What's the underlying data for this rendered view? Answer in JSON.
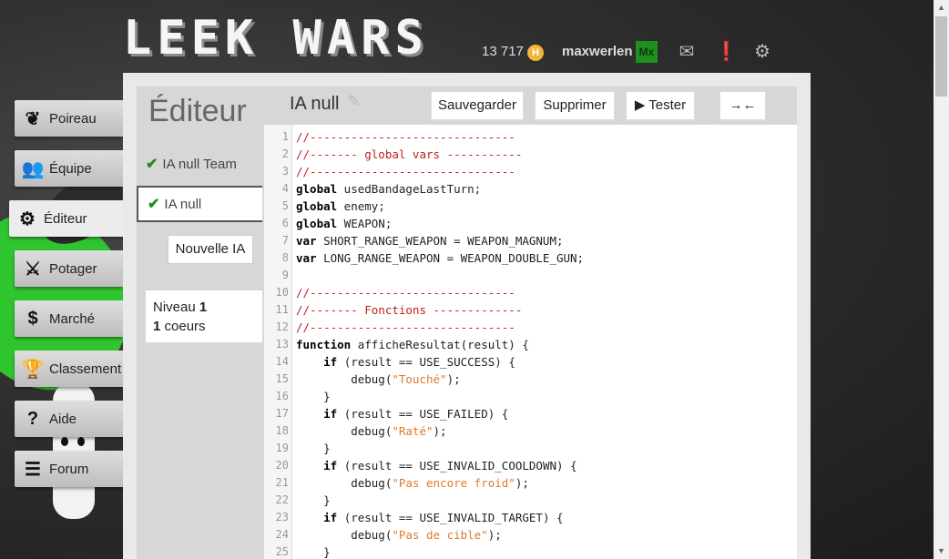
{
  "header": {
    "logo": "LEEK WARS",
    "habs": "13 717",
    "username": "maxwerlen",
    "avatar_text": "Mx"
  },
  "menu": [
    {
      "label": "Poireau",
      "icon": "leek-icon"
    },
    {
      "label": "Équipe",
      "icon": "team-icon"
    },
    {
      "label": "Éditeur",
      "icon": "gear-icon"
    },
    {
      "label": "Potager",
      "icon": "swords-icon"
    },
    {
      "label": "Marché",
      "icon": "dollar-icon"
    },
    {
      "label": "Classement",
      "icon": "trophy-icon"
    },
    {
      "label": "Aide",
      "icon": "question-icon"
    },
    {
      "label": "Forum",
      "icon": "list-icon"
    }
  ],
  "editor_panel": {
    "title": "Éditeur",
    "ai_list": [
      {
        "name": "IA null Team",
        "selected": false
      },
      {
        "name": "IA null",
        "selected": true
      }
    ],
    "new_ai_label": "Nouvelle IA",
    "info": {
      "level_label": "Niveau",
      "level_value": "1",
      "hearts_value": "1",
      "hearts_label": "coeurs"
    }
  },
  "file": {
    "name": "IA null",
    "buttons": {
      "save": "Sauvegarder",
      "delete": "Supprimer",
      "test": "▶ Tester",
      "expand": "→←"
    }
  },
  "code_lines": [
    "//------------------------------",
    "//------- global vars -----------",
    "//------------------------------",
    "global usedBandageLastTurn;",
    "global enemy;",
    "global WEAPON;",
    "var SHORT_RANGE_WEAPON = WEAPON_MAGNUM;",
    "var LONG_RANGE_WEAPON = WEAPON_DOUBLE_GUN;",
    "",
    "//------------------------------",
    "//------- Fonctions -------------",
    "//------------------------------",
    "function afficheResultat(result) {",
    "    if (result == USE_SUCCESS) {",
    "        debug(\"Touché\");",
    "    }",
    "    if (result == USE_FAILED) {",
    "        debug(\"Raté\");",
    "    }",
    "    if (result == USE_INVALID_COOLDOWN) {",
    "        debug(\"Pas encore froid\");",
    "    }",
    "    if (result == USE_INVALID_TARGET) {",
    "        debug(\"Pas de cible\");",
    "    }"
  ],
  "colors": {
    "comment": "#c02020",
    "string": "#e07a2a",
    "accent_green": "#2fc52f"
  }
}
